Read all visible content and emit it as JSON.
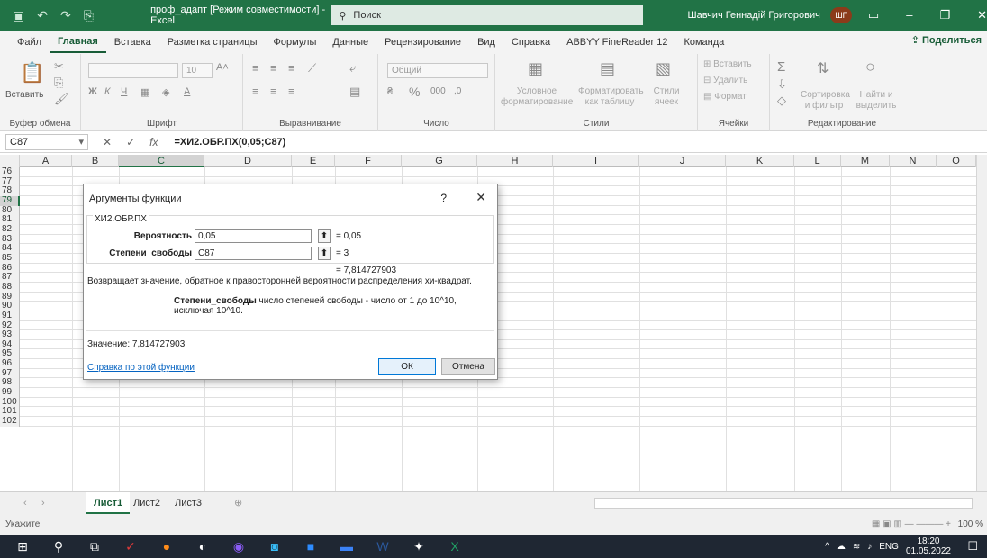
{
  "window": {
    "title": "проф_адапт [Режим совместимости] - Excel",
    "search": "Поиск",
    "user": "Шавчич Геннадій Григорович",
    "user_initials": "ШГ"
  },
  "menu": {
    "items": [
      "Файл",
      "Главная",
      "Вставка",
      "Разметка страницы",
      "Формулы",
      "Данные",
      "Рецензирование",
      "Вид",
      "Справка",
      "ABBYY FineReader 12",
      "Команда"
    ],
    "share": "Поделиться"
  },
  "ribbon": {
    "paste": "Вставить",
    "clipboard": "Буфер обмена",
    "font_size": "10",
    "font": "Шрифт",
    "alignment": "Выравнивание",
    "number_format": "Общий",
    "number": "Число",
    "cond_format": "Условное форматирование",
    "format_table": "Форматировать как таблицу",
    "cell_styles": "Стили ячеек",
    "styles": "Стили",
    "insert": "Вставить",
    "delete": "Удалить",
    "format": "Формат",
    "cells": "Ячейки",
    "sort": "Сортировка и фильтр",
    "find": "Найти и выделить",
    "editing": "Редактирование"
  },
  "formula_bar": {
    "cell": "C87",
    "formula": "=ХИ2.ОБР.ПХ(0,05;C87)"
  },
  "grid": {
    "columns": [
      "A",
      "B",
      "C",
      "D",
      "E",
      "F",
      "G",
      "H",
      "I",
      "J",
      "K",
      "L",
      "M",
      "N",
      "O"
    ],
    "rows": [
      "76",
      "77",
      "78",
      "79",
      "80",
      "81",
      "82",
      "83",
      "84",
      "85",
      "86",
      "87",
      "88",
      "89",
      "90",
      "91",
      "92",
      "93",
      "94",
      "95",
      "96",
      "97",
      "98",
      "99",
      "100",
      "101",
      "102"
    ]
  },
  "sheets": {
    "tabs": [
      "Лист1",
      "Лист2",
      "Лист3"
    ],
    "active": "Лист1"
  },
  "status": {
    "mode": "Укажите",
    "zoom": "100 %"
  },
  "dialog": {
    "title": "Аргументы функции",
    "help": "?",
    "close": "✕",
    "function": "ХИ2.ОБР.ПХ",
    "arg1_label": "Вероятность",
    "arg1_value": "0,05",
    "arg1_result": "=  0,05",
    "arg2_label": "Степени_свободы",
    "arg2_value": "C87",
    "arg2_result": "=  3",
    "result": "=  7,814727903",
    "description": "Возвращает значение, обратное к правосторонней вероятности распределения хи-квадрат.",
    "param_name": "Степени_свободы",
    "param_desc": "число степеней свободы - число от 1 до 10^10, исключая 10^10.",
    "value_label": "Значение:  7,814727903",
    "help_link": "Справка по этой функции",
    "ok": "ОК",
    "cancel": "Отмена"
  },
  "taskbar": {
    "lang": "ENG",
    "time": "18:20",
    "date": "01.05.2022"
  }
}
